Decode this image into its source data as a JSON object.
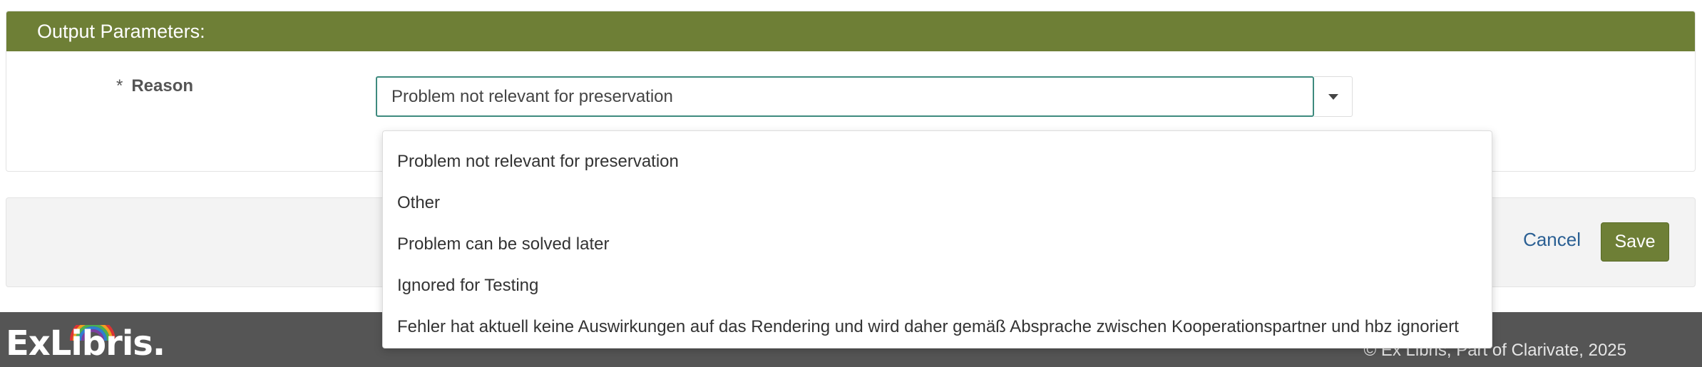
{
  "panel": {
    "title": "Output Parameters:",
    "field_required_marker": "*",
    "field_label": "Reason",
    "selected_value": "Problem not relevant for preservation"
  },
  "dropdown": {
    "options": [
      "Problem not relevant for preservation",
      "Other",
      "Problem can be solved later",
      "Ignored for Testing",
      "Fehler hat aktuell keine Auswirkungen auf das Rendering und wird daher gemäß Absprache zwischen Kooperationspartner und hbz ignoriert"
    ]
  },
  "actions": {
    "cancel_label": "Cancel",
    "save_label": "Save"
  },
  "footer": {
    "logo_text": "ExLibris.",
    "copyright": "© Ex Libris, Part of Clarivate, 2025"
  },
  "colors": {
    "header_bg": "#6e7f36",
    "save_bg": "#6e7f36",
    "focus_border": "#3e8a7e",
    "footer_bg": "#555555",
    "link": "#2a5f93"
  },
  "icons": {
    "select_toggle": "caret-down-icon",
    "logo": "exlibris-logo"
  }
}
